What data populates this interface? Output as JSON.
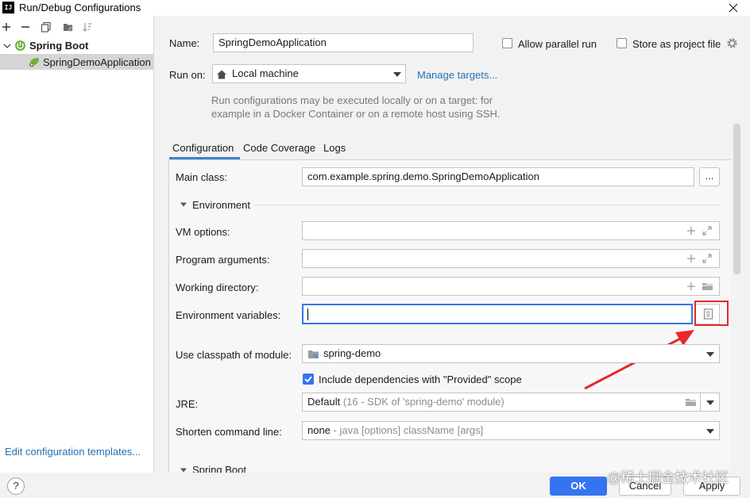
{
  "window": {
    "title": "Run/Debug Configurations",
    "app_icon_text": "IJ"
  },
  "sidebar": {
    "tree": [
      {
        "label": "Spring Boot",
        "expanded": true
      },
      {
        "label": "SpringDemoApplication",
        "selected": true
      }
    ],
    "edit_templates_link": "Edit configuration templates..."
  },
  "form": {
    "name_label": "Name:",
    "name_value": "SpringDemoApplication",
    "allow_parallel_label": "Allow parallel run",
    "store_as_project_label": "Store as project file",
    "run_on_label": "Run on:",
    "run_on_value": "Local machine",
    "manage_targets_link": "Manage targets...",
    "hint_line1": "Run configurations may be executed locally or on a target: for",
    "hint_line2": "example in a Docker Container or on a remote host using SSH."
  },
  "tabs": [
    "Configuration",
    "Code Coverage",
    "Logs"
  ],
  "config": {
    "main_class_label": "Main class:",
    "main_class_value": "com.example.spring.demo.SpringDemoApplication",
    "browse_label": "...",
    "environment_label": "Environment",
    "vm_options_label": "VM options:",
    "program_args_label": "Program arguments:",
    "working_dir_label": "Working directory:",
    "env_vars_label": "Environment variables:",
    "classpath_label": "Use classpath of module:",
    "classpath_value": "spring-demo",
    "include_deps_label": "Include dependencies with \"Provided\" scope",
    "jre_label": "JRE:",
    "jre_value": "Default",
    "jre_hint": "(16 - SDK of 'spring-demo' module)",
    "shorten_label": "Shorten command line:",
    "shorten_value": "none",
    "shorten_hint": "- java [options] className [args]",
    "spring_boot_label": "Spring Boot"
  },
  "footer": {
    "help_label": "?",
    "ok_label": "OK",
    "cancel_label": "Cancel",
    "apply_label": "Apply",
    "watermark": "@稀土掘金技术社区"
  },
  "colors": {
    "accent": "#3574f0",
    "link": "#2470b3",
    "highlight": "#e8272b",
    "spring_green": "#6db33f"
  }
}
